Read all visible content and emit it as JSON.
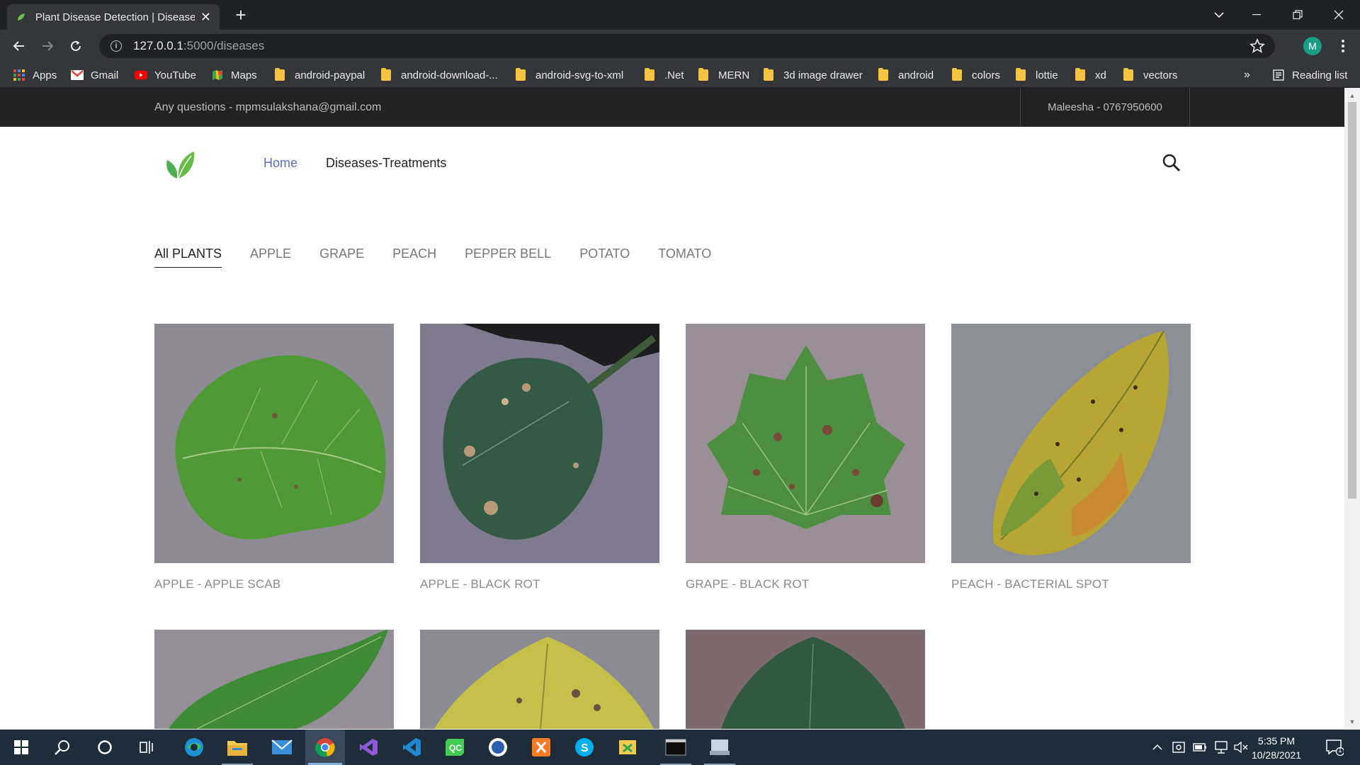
{
  "browser": {
    "tab_title": "Plant Disease Detection | Diseases",
    "url_host": "127.0.0.1",
    "url_path": ":5000/diseases",
    "profile_initial": "M",
    "bookmarks": [
      {
        "label": "Apps",
        "icon": "apps-grid-icon"
      },
      {
        "label": "Gmail",
        "icon": "gmail-icon"
      },
      {
        "label": "YouTube",
        "icon": "youtube-icon"
      },
      {
        "label": "Maps",
        "icon": "maps-icon"
      },
      {
        "label": "android-paypal",
        "icon": "folder-icon"
      },
      {
        "label": "android-download-...",
        "icon": "folder-icon"
      },
      {
        "label": "android-svg-to-xml",
        "icon": "folder-icon"
      },
      {
        "label": ".Net",
        "icon": "folder-icon"
      },
      {
        "label": "MERN",
        "icon": "folder-icon"
      },
      {
        "label": "3d image drawer",
        "icon": "folder-icon"
      },
      {
        "label": "android",
        "icon": "folder-icon"
      },
      {
        "label": "colors",
        "icon": "folder-icon"
      },
      {
        "label": "lottie",
        "icon": "folder-icon"
      },
      {
        "label": "xd",
        "icon": "folder-icon"
      },
      {
        "label": "vectors",
        "icon": "folder-icon"
      }
    ],
    "overflow": "»",
    "reading_list": "Reading list"
  },
  "site": {
    "topbar_left": "Any questions - mpmsulakshana@gmail.com",
    "topbar_right": "Maleesha - 0767950600",
    "nav_home": "Home",
    "nav_diseases": "Diseases-Treatments",
    "accent_color": "#5c6bc0",
    "filters": [
      "All PLANTS",
      "APPLE",
      "GRAPE",
      "PEACH",
      "PEPPER BELL",
      "POTATO",
      "TOMATO"
    ],
    "cards": [
      {
        "caption": "APPLE - APPLE SCAB"
      },
      {
        "caption": "APPLE - BLACK ROT"
      },
      {
        "caption": "GRAPE - BLACK ROT"
      },
      {
        "caption": "PEACH - BACTERIAL SPOT"
      }
    ]
  },
  "taskbar": {
    "time": "5:35 PM",
    "date": "10/28/2021",
    "notification_count": "1"
  }
}
